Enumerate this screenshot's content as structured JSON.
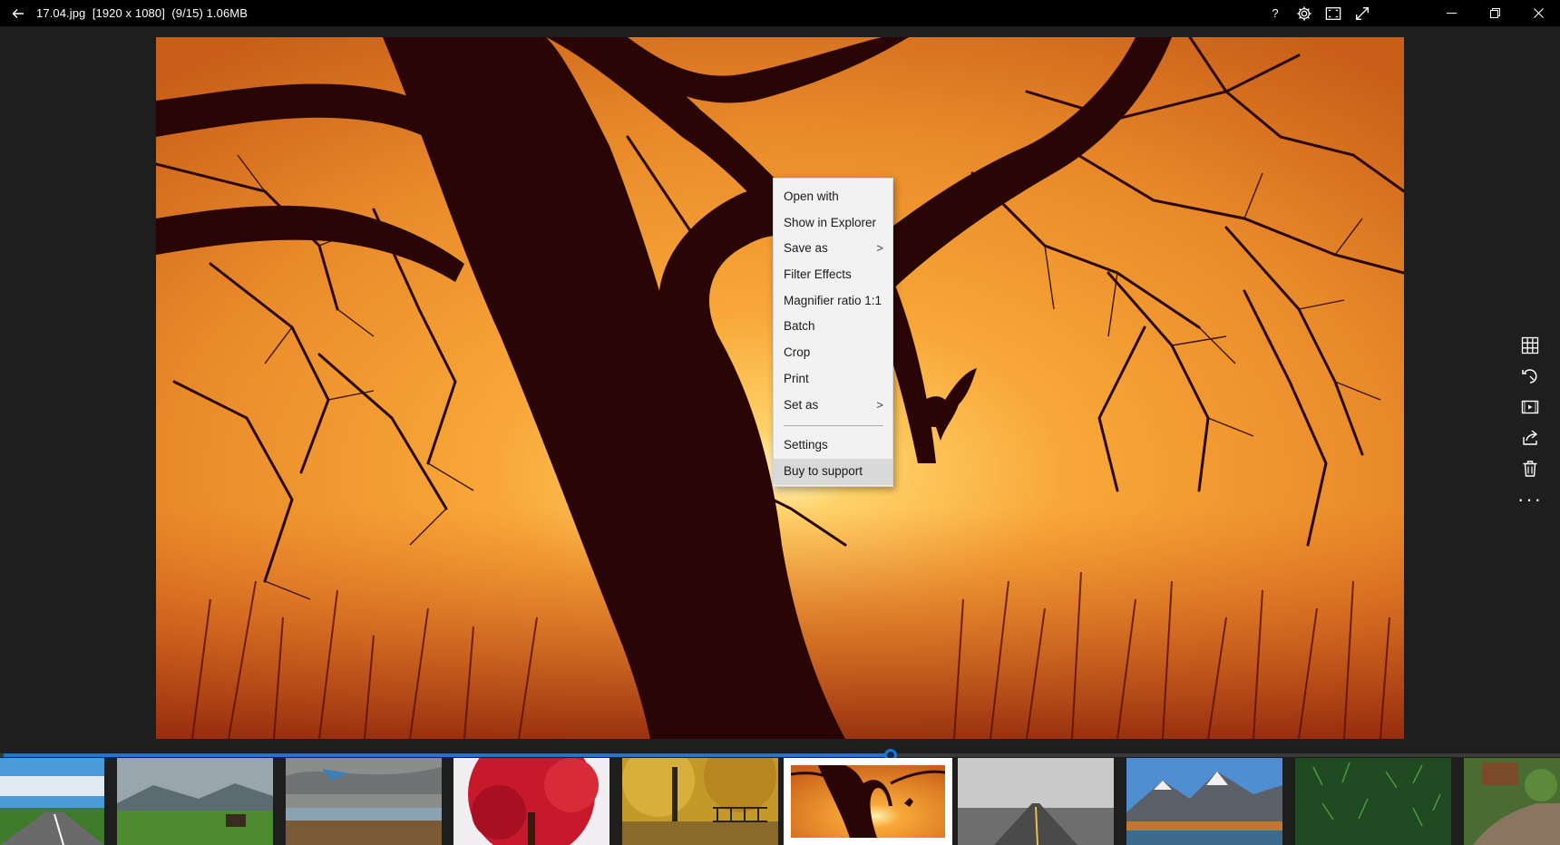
{
  "titlebar": {
    "title": "17.04.jpg  [1920 x 1080]  (9/15) 1.06MB",
    "help": "?",
    "icons": [
      "back-arrow-icon",
      "gear-icon",
      "fit-screen-icon",
      "fullscreen-icon",
      "minimize-icon",
      "restore-icon",
      "close-icon"
    ]
  },
  "context_menu": {
    "items": [
      {
        "label": "Open with"
      },
      {
        "label": "Show in Explorer"
      },
      {
        "label": "Save as",
        "submenu": ">"
      },
      {
        "label": "Filter Effects"
      },
      {
        "label": "Magnifier ratio 1:1"
      },
      {
        "label": "Batch"
      },
      {
        "label": "Crop"
      },
      {
        "label": "Print"
      },
      {
        "label": "Set as",
        "submenu": ">"
      },
      {
        "label": "Settings"
      },
      {
        "label": "Buy to support"
      }
    ]
  },
  "rail": {
    "icons": [
      "grid-icon",
      "rotate-icon",
      "slideshow-icon",
      "share-icon",
      "trash-icon",
      "more-icon"
    ],
    "more": "···"
  },
  "slider": {
    "position": 0.571
  },
  "thumbnails": {
    "count_visible": 10,
    "selected_index": 5,
    "themes": [
      "mountain-road",
      "valley-house",
      "lake-clouds",
      "red-tree",
      "autumn-park",
      "sunset-tree",
      "foggy-road",
      "snowy-mountains",
      "green-pine",
      "garden"
    ]
  },
  "colors": {
    "accent": "#1e74d8",
    "titlebar_bg": "#000000",
    "window_bg": "#1e1e1e",
    "menu_bg": "#f2f2f2",
    "menu_highlight": "#d9d9d9"
  }
}
